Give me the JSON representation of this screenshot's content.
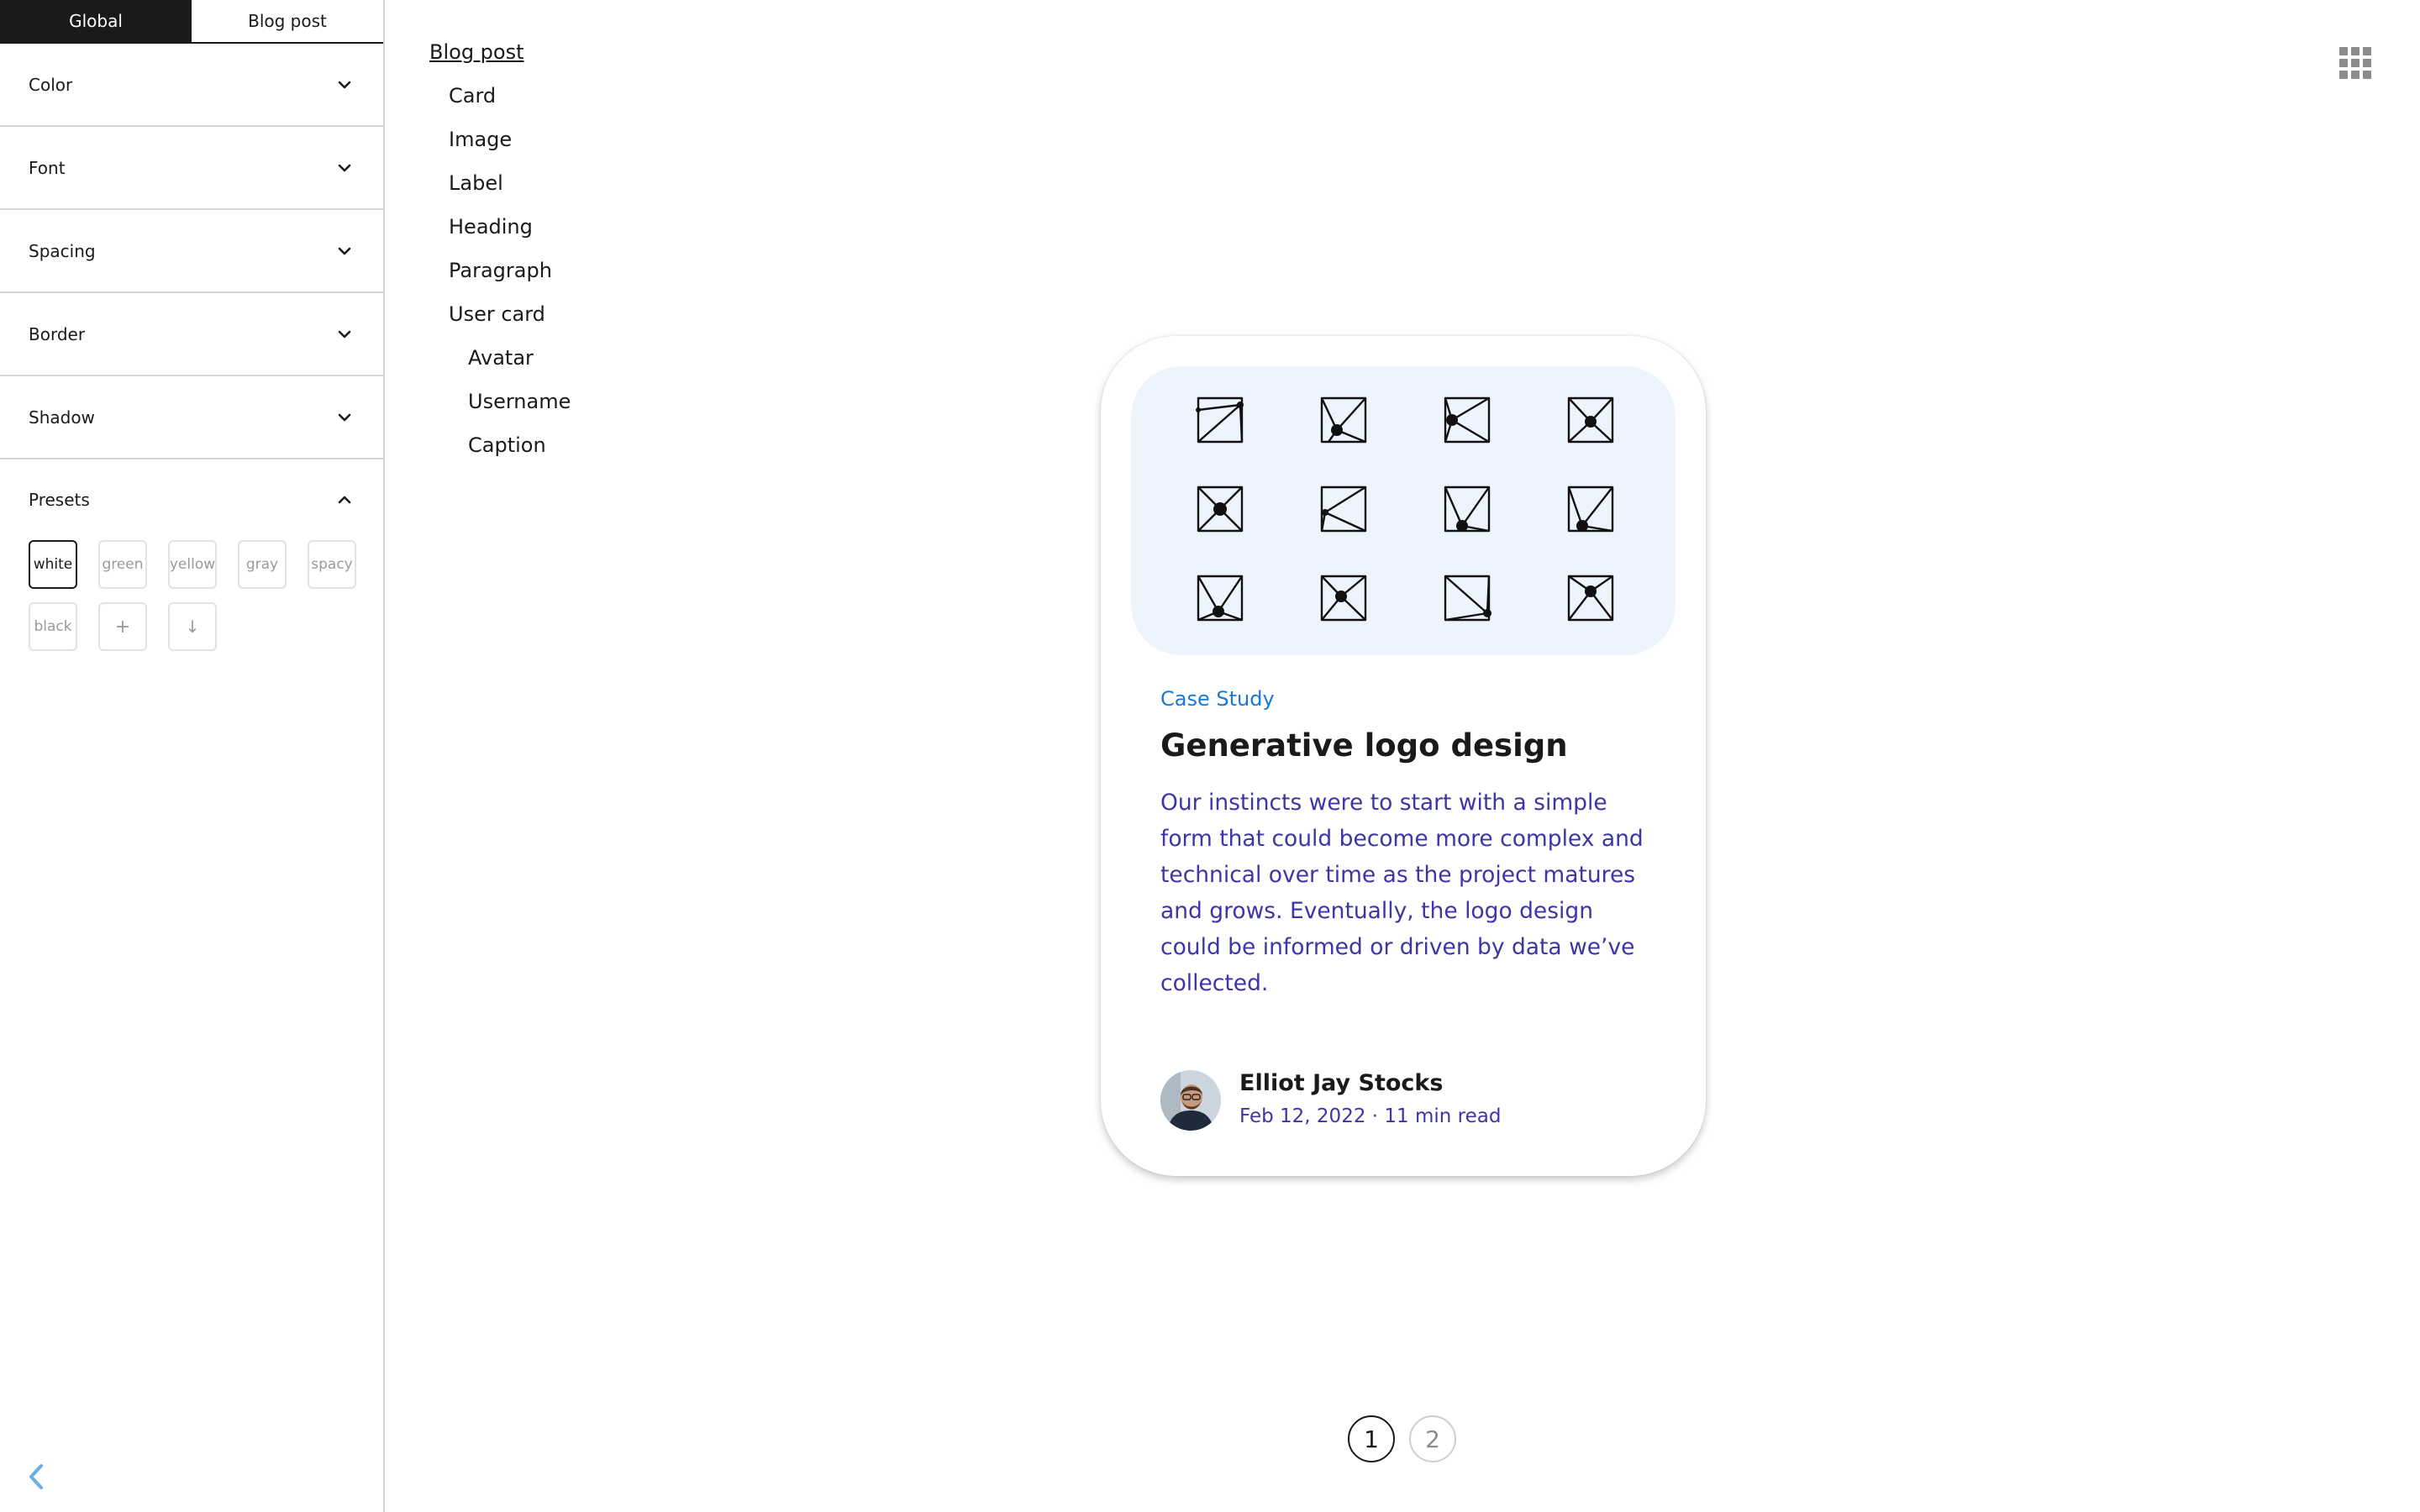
{
  "tabs": [
    {
      "label": "Global",
      "active": true
    },
    {
      "label": "Blog post",
      "active": false
    }
  ],
  "sections": [
    "Color",
    "Font",
    "Spacing",
    "Border",
    "Shadow"
  ],
  "presets": {
    "label": "Presets",
    "items": [
      "white",
      "green",
      "yellow",
      "gray",
      "spacy",
      "black"
    ],
    "selected": "white",
    "add_icon": "+",
    "download_icon": "↓"
  },
  "tree": {
    "root": "Blog post",
    "items": [
      "Card",
      "Image",
      "Label",
      "Heading",
      "Paragraph",
      "User card",
      "Avatar",
      "Username",
      "Caption"
    ]
  },
  "card": {
    "label": "Case Study",
    "heading": "Generative logo design",
    "paragraph": "Our instincts were to start with a simple form that could become more complex and technical over time as the project matures and grows. Eventually, the logo design could be informed or driven by data we’ve collected.",
    "username": "Elliot Jay Stocks",
    "caption": "Feb 12, 2022 · 11 min read",
    "image_background": "#eef4fe"
  },
  "pagination": {
    "current": "1",
    "other": "2"
  },
  "colors": {
    "accent_label": "#1a78d4",
    "paragraph": "#3d35a8",
    "dark": "#1a1a1a",
    "collapse_arrow": "#6aaee8"
  },
  "icons": {
    "section_toggle": "chevron-down-icon",
    "presets_toggle": "chevron-up-icon",
    "collapse": "chevron-left-icon",
    "top_right_menu": "grid-menu-icon"
  }
}
